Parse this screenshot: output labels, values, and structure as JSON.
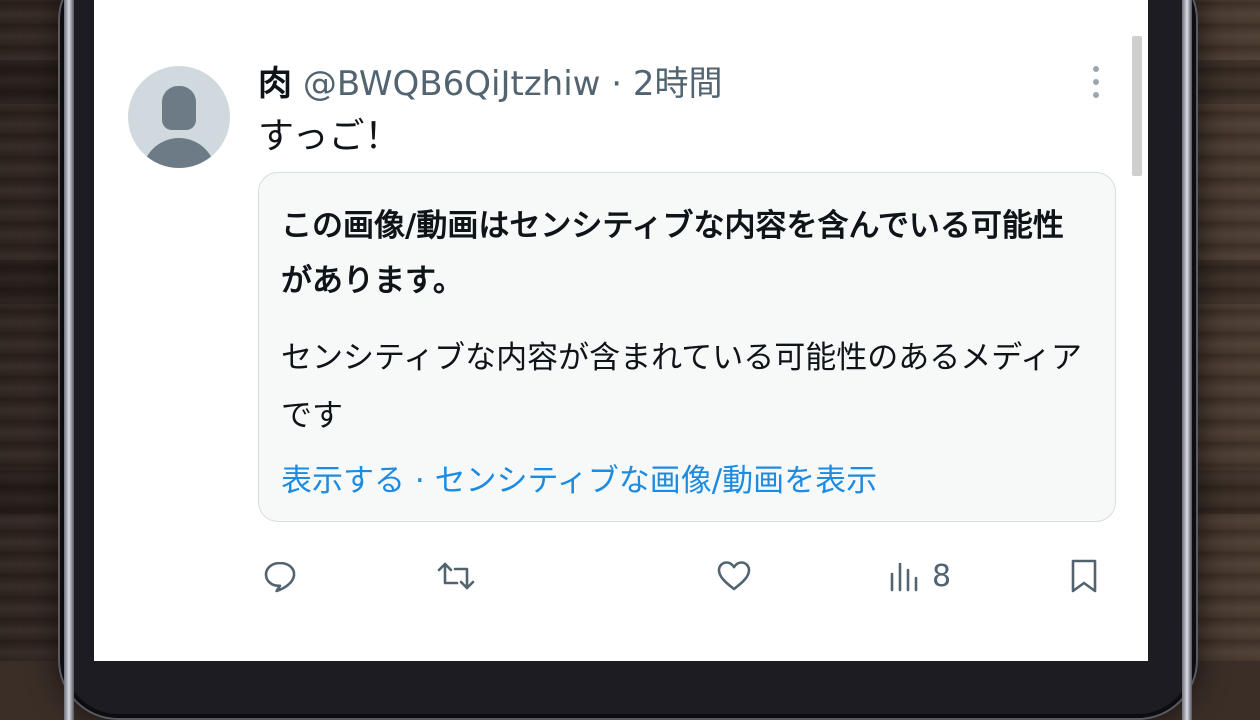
{
  "tweet": {
    "display_name": "肉",
    "handle": "@BWQB6QiJtzhiw",
    "separator": " · ",
    "time": "2時間",
    "text": "すっご！"
  },
  "sensitive_card": {
    "title": "この画像/動画はセンシティブな内容を含んでいる可能性があります。",
    "description": "センシティブな内容が含まれている可能性のあるメディアです",
    "show_label": "表示する",
    "link_separator": " · ",
    "show_media_label": "センシティブな画像/動画を表示"
  },
  "actions": {
    "reply_icon": "reply-icon",
    "retweet_icon": "retweet-icon",
    "like_icon": "like-icon",
    "views_icon": "views-icon",
    "views_count": "8",
    "bookmark_icon": "bookmark-icon",
    "share_icon": "share-icon"
  },
  "colors": {
    "link": "#1d8ce0",
    "text": "#0f1419",
    "secondary_text": "#536471",
    "card_background": "#f7f9f9"
  }
}
